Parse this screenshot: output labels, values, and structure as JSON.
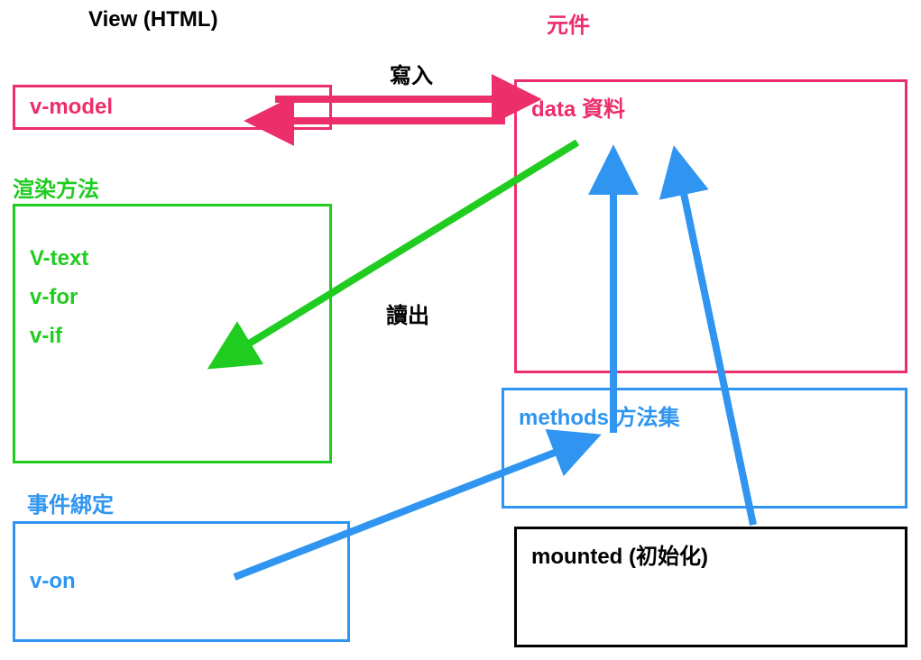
{
  "headers": {
    "left": "View (HTML)",
    "right": "元件"
  },
  "labels": {
    "write": "寫入",
    "read": "讀出",
    "renderMethods": "渲染方法",
    "eventBinding": "事件綁定"
  },
  "boxes": {
    "vmodel": "v-model",
    "data": "data 資料",
    "render": {
      "line1": "V-text",
      "line2": "v-for",
      "line3": "v-if"
    },
    "methods": "methods 方法集",
    "von": "v-on",
    "mounted": "mounted (初始化)"
  },
  "colors": {
    "pink": "#ec2e6a",
    "green": "#1fcc1f",
    "blue": "#2f95f0",
    "black": "#000000"
  }
}
